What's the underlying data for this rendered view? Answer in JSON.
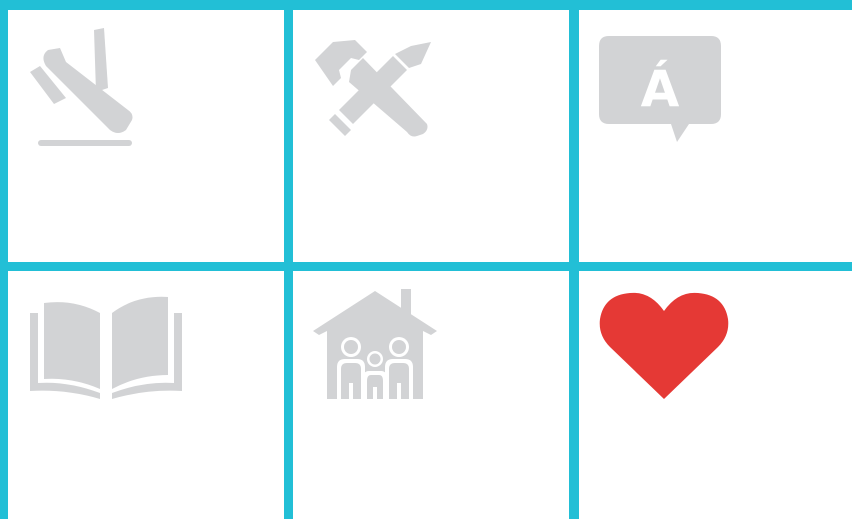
{
  "colors": {
    "grid_lines": "#22bfd6",
    "tile_background": "#ffffff",
    "icon_gray": "#d2d3d5",
    "heart_red": "#e53935"
  },
  "tiles": [
    {
      "icon": "airplane-landing-icon"
    },
    {
      "icon": "hammer-and-pencil-icon"
    },
    {
      "icon": "speech-bubble-accent-icon",
      "glyph": "Á"
    },
    {
      "icon": "open-book-icon"
    },
    {
      "icon": "family-house-icon"
    },
    {
      "icon": "heart-icon"
    }
  ]
}
